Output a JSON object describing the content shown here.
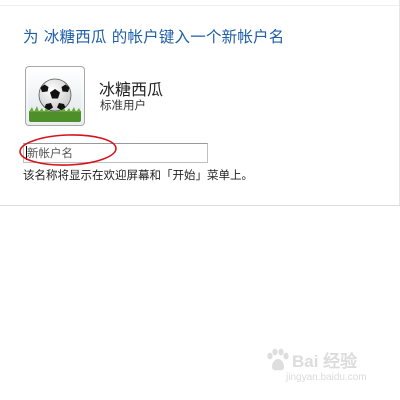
{
  "dialog": {
    "title": "为 冰糖西瓜 的帐户键入一个新帐户名"
  },
  "account": {
    "name": "冰糖西瓜",
    "role": "标准用户",
    "avatar_icon": "soccer-ball-avatar"
  },
  "rename": {
    "input_value": "",
    "input_placeholder": "新帐户名",
    "hint": "该名称将显示在欢迎屏幕和「开始」菜单上。"
  },
  "annotation": {
    "highlight_color": "#d4151b"
  },
  "watermark": {
    "brand": "Bai 经验",
    "url": "jingyan.baidu.com"
  },
  "colors": {
    "title": "#1f5fa8",
    "background": "#ffffff"
  }
}
